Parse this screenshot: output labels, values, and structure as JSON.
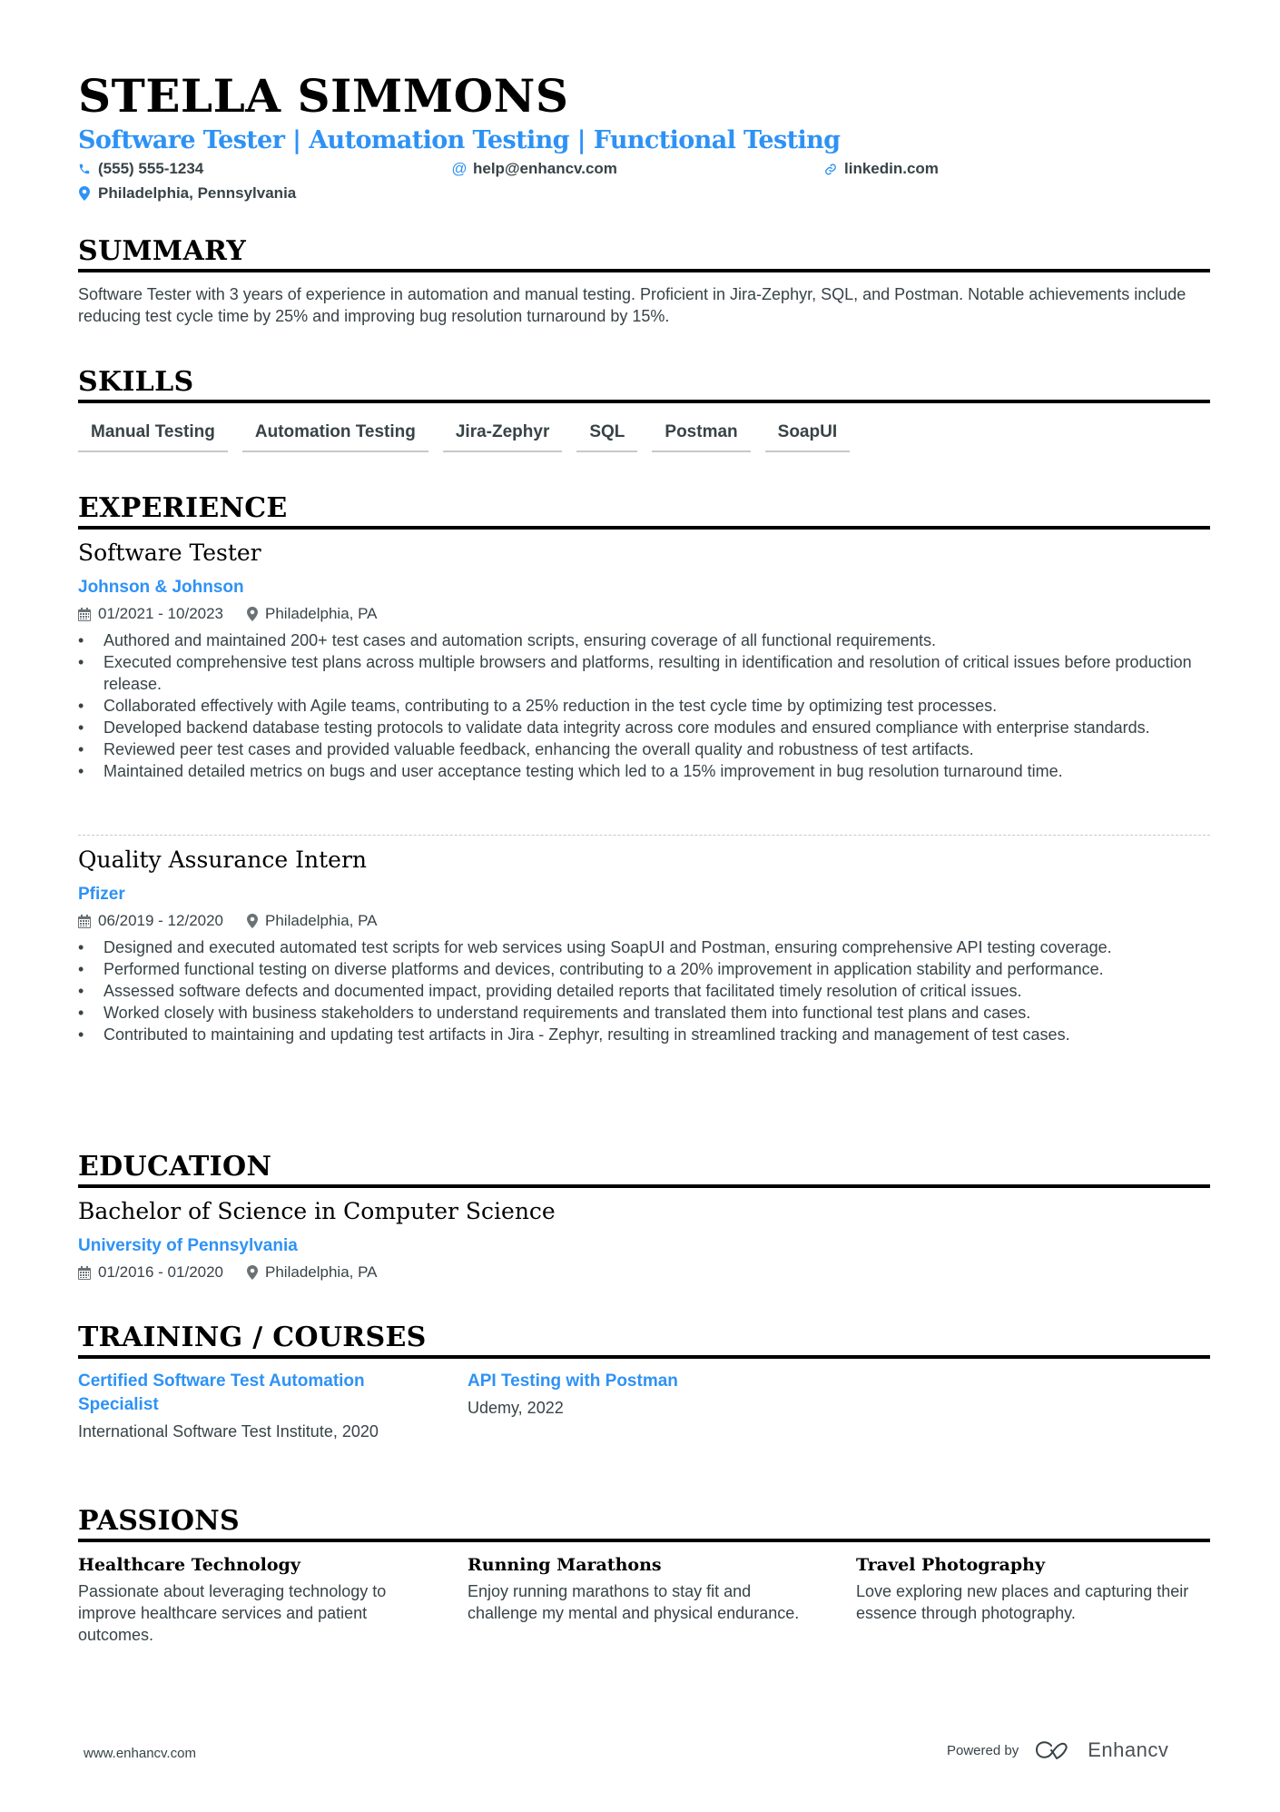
{
  "header": {
    "name": "STELLA SIMMONS",
    "headline": "Software Tester | Automation Testing | Functional Testing",
    "phone": "(555) 555-1234",
    "email": "help@enhancv.com",
    "linkedin": "linkedin.com",
    "location": "Philadelphia, Pennsylvania",
    "icons": {
      "phone": "phone-icon",
      "email": "at-icon",
      "linkedin": "link-icon",
      "location": "map-pin-icon"
    }
  },
  "colors": {
    "accent": "#2e92f5",
    "text": "#384347",
    "heading": "#000000"
  },
  "summary": {
    "title": "SUMMARY",
    "text": "Software Tester with 3 years of experience in automation and manual testing. Proficient in Jira-Zephyr, SQL, and Postman. Notable achievements include reducing test cycle time by 25% and improving bug resolution turnaround by 15%."
  },
  "skills": {
    "title": "SKILLS",
    "items": [
      "Manual Testing",
      "Automation Testing",
      "Jira-Zephyr",
      "SQL",
      "Postman",
      "SoapUI"
    ]
  },
  "experience": {
    "title": "EXPERIENCE",
    "jobs": [
      {
        "title": "Software Tester",
        "company": "Johnson & Johnson",
        "dates": "01/2021 - 10/2023",
        "location": "Philadelphia, PA",
        "bullets": [
          "Authored and maintained 200+ test cases and automation scripts, ensuring coverage of all functional requirements.",
          "Executed comprehensive test plans across multiple browsers and platforms, resulting in identification and resolution of critical issues before production release.",
          "Collaborated effectively with Agile teams, contributing to a 25% reduction in the test cycle time by optimizing test processes.",
          "Developed backend database testing protocols to validate data integrity across core modules and ensured compliance with enterprise standards.",
          "Reviewed peer test cases and provided valuable feedback, enhancing the overall quality and robustness of test artifacts.",
          "Maintained detailed metrics on bugs and user acceptance testing which led to a 15% improvement in bug resolution turnaround time."
        ]
      },
      {
        "title": "Quality Assurance Intern",
        "company": "Pfizer",
        "dates": "06/2019 - 12/2020",
        "location": "Philadelphia, PA",
        "bullets": [
          "Designed and executed automated test scripts for web services using SoapUI and Postman, ensuring comprehensive API testing coverage.",
          "Performed functional testing on diverse platforms and devices, contributing to a 20% improvement in application stability and performance.",
          "Assessed software defects and documented impact, providing detailed reports that facilitated timely resolution of critical issues.",
          "Worked closely with business stakeholders to understand requirements and translated them into functional test plans and cases.",
          "Contributed to maintaining and updating test artifacts in Jira - Zephyr, resulting in streamlined tracking and management of test cases."
        ]
      }
    ]
  },
  "education": {
    "title": "EDUCATION",
    "degree": "Bachelor of Science in Computer Science",
    "school": "University of Pennsylvania",
    "dates": "01/2016 - 01/2020",
    "location": "Philadelphia, PA"
  },
  "training": {
    "title": "TRAINING / COURSES",
    "items": [
      {
        "name": "Certified Software Test Automation Specialist",
        "source": "International Software Test Institute, 2020"
      },
      {
        "name": "API Testing with Postman",
        "source": "Udemy, 2022"
      }
    ]
  },
  "passions": {
    "title": "PASSIONS",
    "items": [
      {
        "name": "Healthcare Technology",
        "desc": "Passionate about leveraging technology to improve healthcare services and patient outcomes."
      },
      {
        "name": "Running Marathons",
        "desc": "Enjoy running marathons to stay fit and challenge my mental and physical endurance."
      },
      {
        "name": "Travel Photography",
        "desc": "Love exploring new places and capturing their essence through photography."
      }
    ]
  },
  "footer": {
    "website": "www.enhancv.com",
    "powered_by": "Powered by",
    "brand": "Enhancv"
  }
}
